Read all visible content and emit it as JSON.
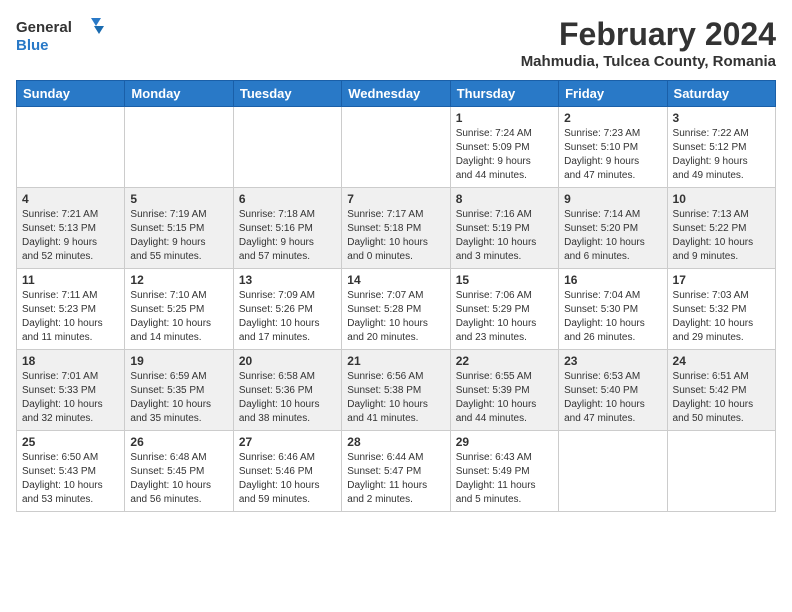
{
  "header": {
    "logo_general": "General",
    "logo_blue": "Blue",
    "month_year": "February 2024",
    "location": "Mahmudia, Tulcea County, Romania"
  },
  "weekdays": [
    "Sunday",
    "Monday",
    "Tuesday",
    "Wednesday",
    "Thursday",
    "Friday",
    "Saturday"
  ],
  "weeks": [
    [
      {
        "day": "",
        "info": ""
      },
      {
        "day": "",
        "info": ""
      },
      {
        "day": "",
        "info": ""
      },
      {
        "day": "",
        "info": ""
      },
      {
        "day": "1",
        "info": "Sunrise: 7:24 AM\nSunset: 5:09 PM\nDaylight: 9 hours\nand 44 minutes."
      },
      {
        "day": "2",
        "info": "Sunrise: 7:23 AM\nSunset: 5:10 PM\nDaylight: 9 hours\nand 47 minutes."
      },
      {
        "day": "3",
        "info": "Sunrise: 7:22 AM\nSunset: 5:12 PM\nDaylight: 9 hours\nand 49 minutes."
      }
    ],
    [
      {
        "day": "4",
        "info": "Sunrise: 7:21 AM\nSunset: 5:13 PM\nDaylight: 9 hours\nand 52 minutes."
      },
      {
        "day": "5",
        "info": "Sunrise: 7:19 AM\nSunset: 5:15 PM\nDaylight: 9 hours\nand 55 minutes."
      },
      {
        "day": "6",
        "info": "Sunrise: 7:18 AM\nSunset: 5:16 PM\nDaylight: 9 hours\nand 57 minutes."
      },
      {
        "day": "7",
        "info": "Sunrise: 7:17 AM\nSunset: 5:18 PM\nDaylight: 10 hours\nand 0 minutes."
      },
      {
        "day": "8",
        "info": "Sunrise: 7:16 AM\nSunset: 5:19 PM\nDaylight: 10 hours\nand 3 minutes."
      },
      {
        "day": "9",
        "info": "Sunrise: 7:14 AM\nSunset: 5:20 PM\nDaylight: 10 hours\nand 6 minutes."
      },
      {
        "day": "10",
        "info": "Sunrise: 7:13 AM\nSunset: 5:22 PM\nDaylight: 10 hours\nand 9 minutes."
      }
    ],
    [
      {
        "day": "11",
        "info": "Sunrise: 7:11 AM\nSunset: 5:23 PM\nDaylight: 10 hours\nand 11 minutes."
      },
      {
        "day": "12",
        "info": "Sunrise: 7:10 AM\nSunset: 5:25 PM\nDaylight: 10 hours\nand 14 minutes."
      },
      {
        "day": "13",
        "info": "Sunrise: 7:09 AM\nSunset: 5:26 PM\nDaylight: 10 hours\nand 17 minutes."
      },
      {
        "day": "14",
        "info": "Sunrise: 7:07 AM\nSunset: 5:28 PM\nDaylight: 10 hours\nand 20 minutes."
      },
      {
        "day": "15",
        "info": "Sunrise: 7:06 AM\nSunset: 5:29 PM\nDaylight: 10 hours\nand 23 minutes."
      },
      {
        "day": "16",
        "info": "Sunrise: 7:04 AM\nSunset: 5:30 PM\nDaylight: 10 hours\nand 26 minutes."
      },
      {
        "day": "17",
        "info": "Sunrise: 7:03 AM\nSunset: 5:32 PM\nDaylight: 10 hours\nand 29 minutes."
      }
    ],
    [
      {
        "day": "18",
        "info": "Sunrise: 7:01 AM\nSunset: 5:33 PM\nDaylight: 10 hours\nand 32 minutes."
      },
      {
        "day": "19",
        "info": "Sunrise: 6:59 AM\nSunset: 5:35 PM\nDaylight: 10 hours\nand 35 minutes."
      },
      {
        "day": "20",
        "info": "Sunrise: 6:58 AM\nSunset: 5:36 PM\nDaylight: 10 hours\nand 38 minutes."
      },
      {
        "day": "21",
        "info": "Sunrise: 6:56 AM\nSunset: 5:38 PM\nDaylight: 10 hours\nand 41 minutes."
      },
      {
        "day": "22",
        "info": "Sunrise: 6:55 AM\nSunset: 5:39 PM\nDaylight: 10 hours\nand 44 minutes."
      },
      {
        "day": "23",
        "info": "Sunrise: 6:53 AM\nSunset: 5:40 PM\nDaylight: 10 hours\nand 47 minutes."
      },
      {
        "day": "24",
        "info": "Sunrise: 6:51 AM\nSunset: 5:42 PM\nDaylight: 10 hours\nand 50 minutes."
      }
    ],
    [
      {
        "day": "25",
        "info": "Sunrise: 6:50 AM\nSunset: 5:43 PM\nDaylight: 10 hours\nand 53 minutes."
      },
      {
        "day": "26",
        "info": "Sunrise: 6:48 AM\nSunset: 5:45 PM\nDaylight: 10 hours\nand 56 minutes."
      },
      {
        "day": "27",
        "info": "Sunrise: 6:46 AM\nSunset: 5:46 PM\nDaylight: 10 hours\nand 59 minutes."
      },
      {
        "day": "28",
        "info": "Sunrise: 6:44 AM\nSunset: 5:47 PM\nDaylight: 11 hours\nand 2 minutes."
      },
      {
        "day": "29",
        "info": "Sunrise: 6:43 AM\nSunset: 5:49 PM\nDaylight: 11 hours\nand 5 minutes."
      },
      {
        "day": "",
        "info": ""
      },
      {
        "day": "",
        "info": ""
      }
    ]
  ]
}
